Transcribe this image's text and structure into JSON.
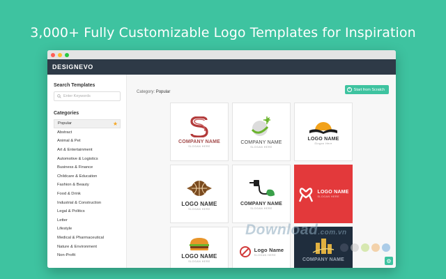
{
  "headline": "3,000+ Fully Customizable Logo Templates for Inspiration",
  "window": {
    "brand": "DESIGNEVO",
    "traffic_lights": [
      "#ff5f57",
      "#ffbd2e",
      "#28c940"
    ]
  },
  "sidebar": {
    "search_title": "Search Templates",
    "search_placeholder": "Enter Keywords",
    "categories_title": "Categories",
    "categories": [
      "Popular",
      "Abstract",
      "Animal & Pet",
      "Art & Entertainment",
      "Automotive & Logistics",
      "Business & Finance",
      "Childcare & Education",
      "Fashion & Beauty",
      "Food & Drink",
      "Industrial & Construction",
      "Legal & Politics",
      "Letter",
      "Lifestyle",
      "Medical & Pharmaceutical",
      "Nature & Environment",
      "Non-Profit"
    ],
    "active_category": "Popular"
  },
  "main": {
    "category_label": "Category:",
    "category_value": "Popular",
    "start_button": "Start from Scratch"
  },
  "templates": [
    {
      "name": "COMPANY NAME",
      "slogan": "SLOGAN HERE",
      "icon": "s-ribbon-logo-icon"
    },
    {
      "name": "COMPANY NAME",
      "slogan": "SLOGAN HERE",
      "icon": "golf-ball-logo-icon"
    },
    {
      "name": "LOGO NAME",
      "slogan": "Slogan Here",
      "icon": "sunrise-book-logo-icon"
    },
    {
      "name": "LOGO NAME",
      "slogan": "SLOGAN HERE",
      "icon": "basketball-logo-icon"
    },
    {
      "name": "COMPANY NAME",
      "slogan": "SLOGAN HERE",
      "icon": "eco-plug-logo-icon"
    },
    {
      "name": "LOGO NAME",
      "slogan": "SLOGAN HERE",
      "icon": "heart-ribbon-logo-icon"
    },
    {
      "name": "LOGO NAME",
      "slogan": "SLOGAN HERE",
      "icon": "burger-logo-icon"
    },
    {
      "name": "Logo Name",
      "slogan": "SLOGAN HERE",
      "icon": "no-sign-logo-icon"
    },
    {
      "name": "COMPANY NAME",
      "slogan": "",
      "icon": "buildings-logo-icon"
    }
  ],
  "watermark": {
    "text": "Download",
    "tld": ".com.vn"
  },
  "colors": {
    "accent": "#3ec3a0",
    "appbar": "#2e3a47",
    "red_tile": "#e3393b",
    "navy_tile": "#1f2d3d"
  }
}
